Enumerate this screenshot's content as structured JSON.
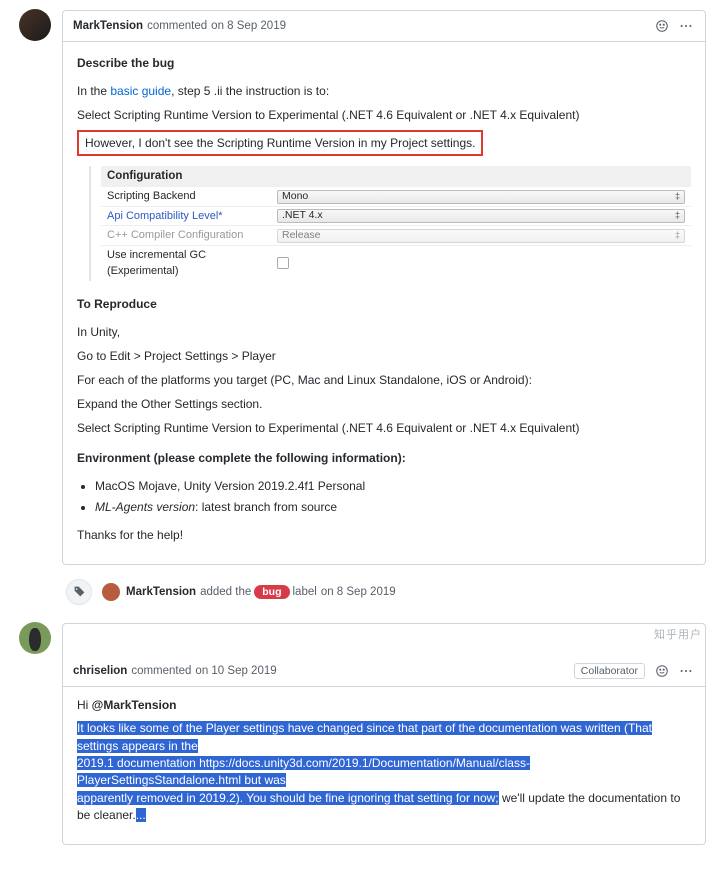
{
  "comment1": {
    "author": "MarkTension",
    "action": "commented",
    "date": "on 8 Sep 2019",
    "h_describe": "Describe the bug",
    "intro_pre": "In the ",
    "intro_link": "basic guide",
    "intro_post": ", step 5 .ii the instruction is to:",
    "line2": "Select Scripting Runtime Version to Experimental (.NET 4.6 Equivalent or .NET 4.x Equivalent)",
    "line3": "However, I don't see the Scripting Runtime Version in my Project settings.",
    "config": {
      "title": "Configuration",
      "rows": [
        {
          "label": "Scripting Backend",
          "style": "",
          "value": "Mono",
          "type": "dd"
        },
        {
          "label": "Api Compatibility Level*",
          "style": "blue",
          "value": ".NET 4.x",
          "type": "dd"
        },
        {
          "label": "C++ Compiler Configuration",
          "style": "grey",
          "value": "Release",
          "type": "dd"
        },
        {
          "label": "Use incremental GC (Experimental)",
          "style": "",
          "value": "",
          "type": "cb"
        }
      ]
    },
    "h_reproduce": "To Reproduce",
    "rep1": "In Unity,",
    "rep2": "Go to Edit > Project Settings > Player",
    "rep3": "For each of the platforms you target (PC, Mac and Linux Standalone, iOS or Android):",
    "rep4": "Expand the Other Settings section.",
    "rep5": "Select Scripting Runtime Version to Experimental (.NET 4.6 Equivalent or .NET 4.x Equivalent)",
    "h_env": "Environment (please complete the following information):",
    "env1": "MacOS Mojave, Unity Version 2019.2.4f1 Personal",
    "env2_i": "ML-Agents version",
    "env2_r": ": latest branch from source",
    "thanks": "Thanks for the help!"
  },
  "event": {
    "author": "MarkTension",
    "pre": "added the",
    "label": "bug",
    "post": "label",
    "date": "on 8 Sep 2019"
  },
  "comment2": {
    "author": "chriselion",
    "action": "commented",
    "date": "on 10 Sep 2019",
    "badge": "Collaborator",
    "greet_pre": "Hi ",
    "greet_mention": "@MarkTension",
    "hl1": "It looks like some of the Player settings have changed since that part of the documentation was written (That settings appears in the ",
    "hl2": "2019.1 documentation https://docs.unity3d.com/2019.1/Documentation/Manual/class-PlayerSettingsStandalone.html but was ",
    "hl3": "apparently removed in 2019.2). You should be fine ignoring that setting for now;",
    "tail": " we'll update the documentation to be cleaner.",
    "ellipsis": "..."
  },
  "watermark": "知乎用户"
}
